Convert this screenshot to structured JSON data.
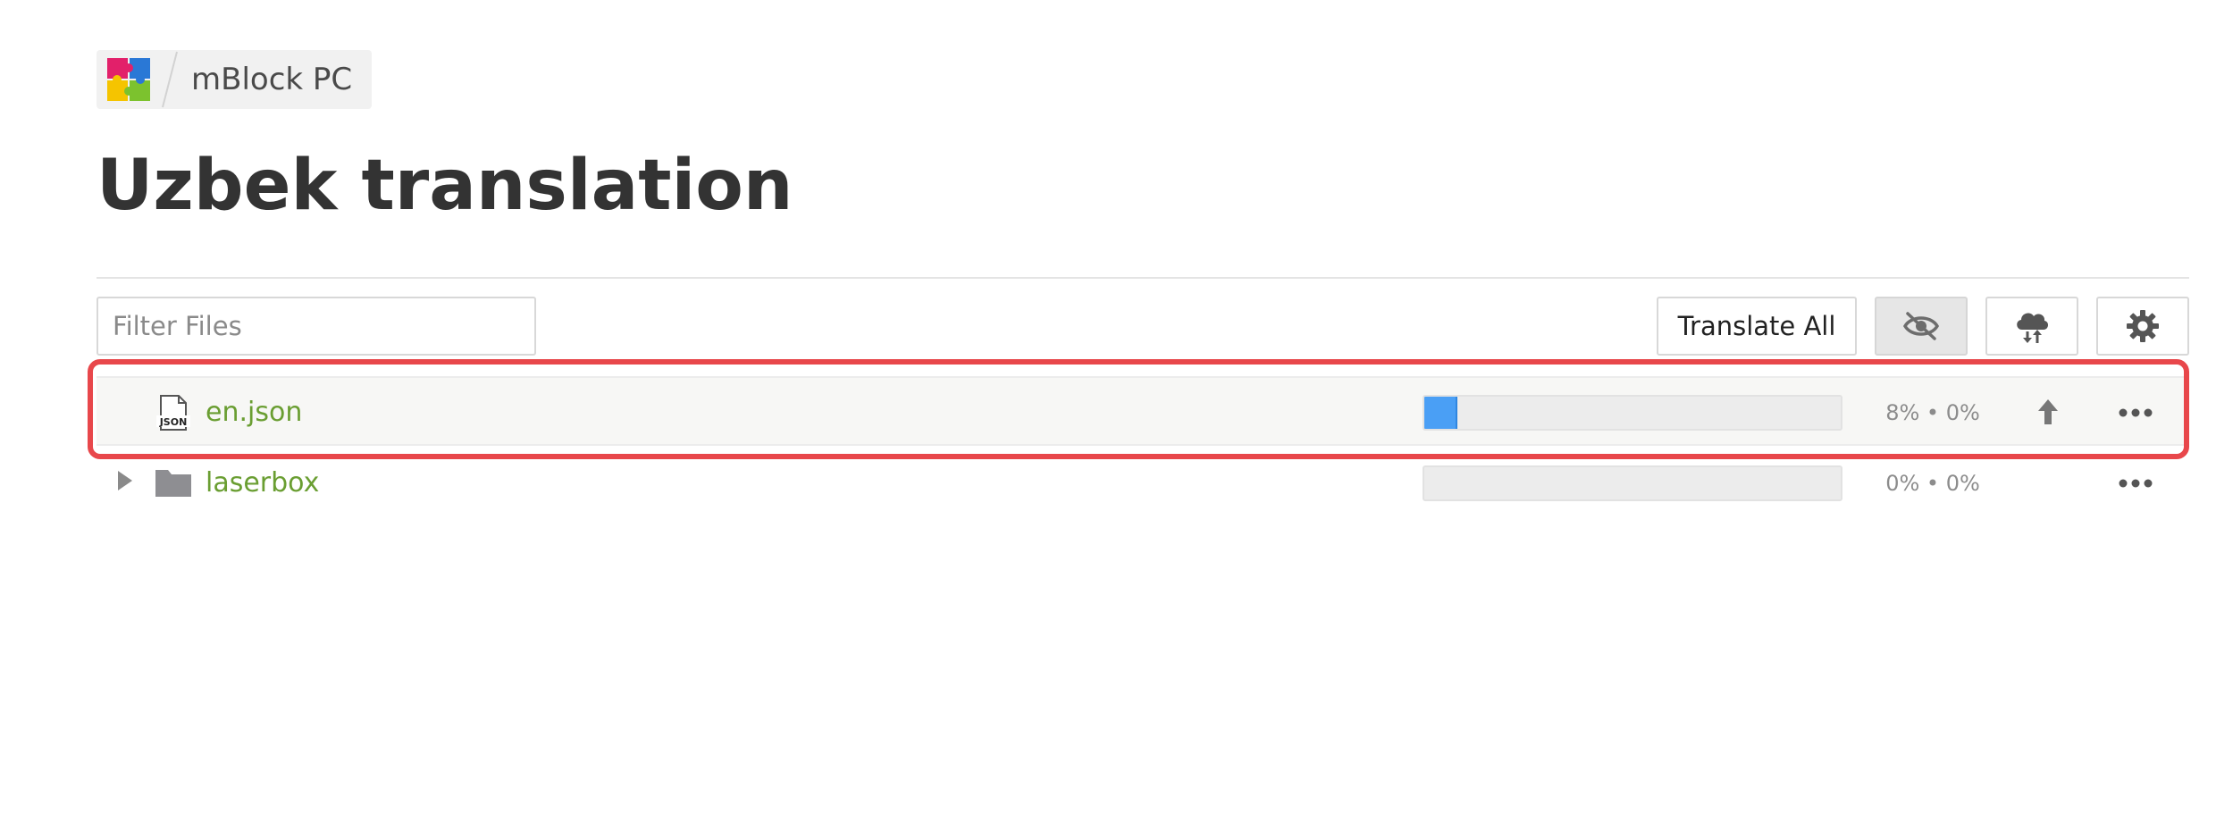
{
  "breadcrumb": {
    "project": "mBlock PC"
  },
  "page": {
    "title": "Uzbek translation"
  },
  "toolbar": {
    "filter_placeholder": "Filter Files",
    "filter_value": "",
    "translate_all_label": "Translate All",
    "hide_icon": "eye-slash-icon",
    "sync_icon": "cloud-sync-icon",
    "settings_icon": "gear-icon"
  },
  "files": [
    {
      "type": "file",
      "name": "en.json",
      "icon": "json-file-icon",
      "progress_text": "8% • 0%",
      "translated_fraction": 0.08,
      "has_upload": true
    },
    {
      "type": "folder",
      "name": "laserbox",
      "icon": "folder-icon",
      "progress_text": "0% • 0%",
      "translated_fraction": 0,
      "has_upload": false
    }
  ],
  "colors": {
    "link_green": "#6a9e32",
    "progress_blue": "#4a9ff5",
    "highlight_red": "#e8474b"
  }
}
